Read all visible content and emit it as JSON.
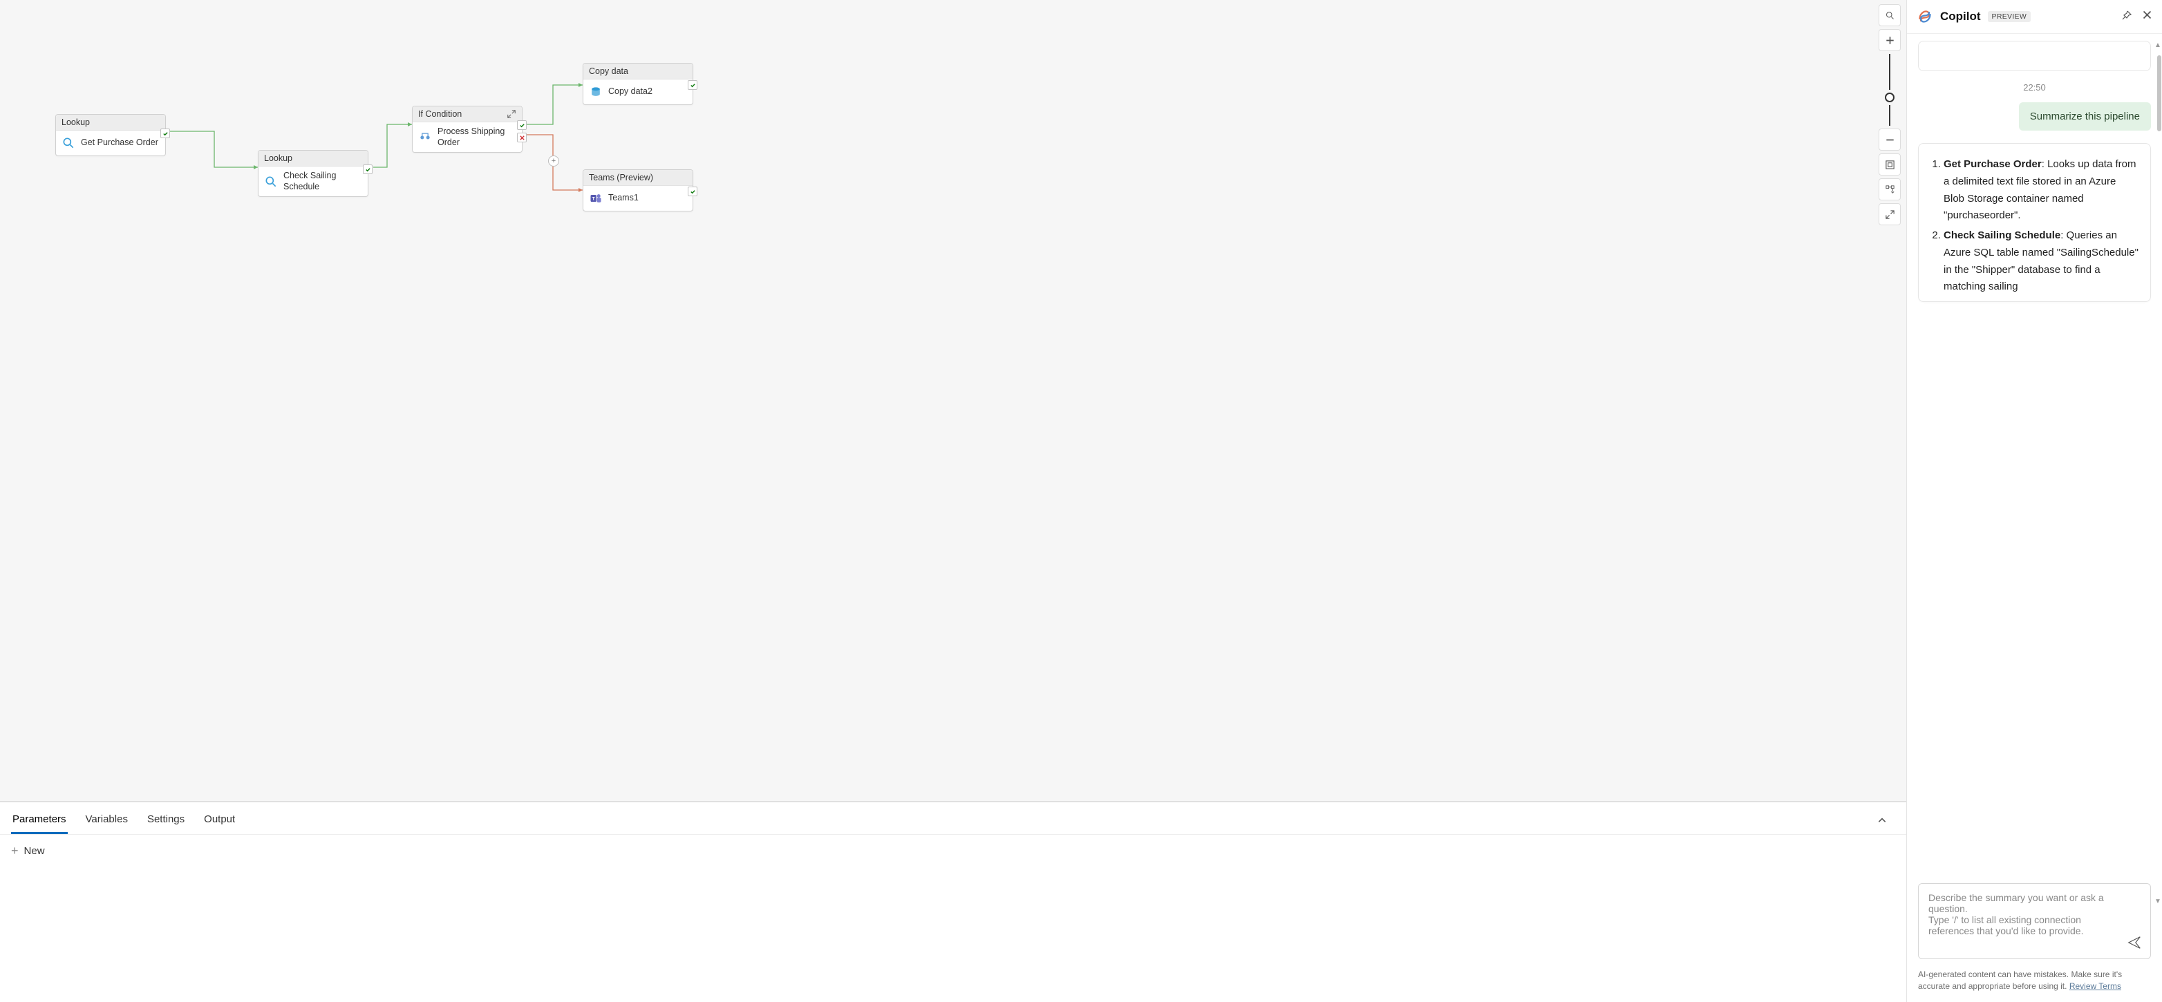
{
  "canvas": {
    "nodes": {
      "n1": {
        "type": "Lookup",
        "label": "Get Purchase Order"
      },
      "n2": {
        "type": "Lookup",
        "label": "Check Sailing Schedule"
      },
      "n3": {
        "type": "If Condition",
        "label": "Process Shipping Order"
      },
      "n4": {
        "type": "Copy data",
        "label": "Copy data2"
      },
      "n5": {
        "type": "Teams (Preview)",
        "label": "Teams1"
      }
    }
  },
  "bottom_panel": {
    "tabs": [
      "Parameters",
      "Variables",
      "Settings",
      "Output"
    ],
    "active_tab": "Parameters",
    "new_label": "New"
  },
  "copilot": {
    "title": "Copilot",
    "badge": "PREVIEW",
    "timestamp": "22:50",
    "user_message": "Summarize this pipeline",
    "assistant": {
      "item1_bold": "Get Purchase Order",
      "item1_text": ": Looks up data from a delimited text file stored in an Azure Blob Storage container named \"purchaseorder\".",
      "item2_bold": "Check Sailing Schedule",
      "item2_text": ": Queries an Azure SQL table named \"SailingSchedule\" in the \"Shipper\" database to find a matching sailing"
    },
    "input_placeholder_line1": "Describe the summary you want or ask a question.",
    "input_placeholder_line2": "Type '/' to list all existing connection references that you'd like to provide.",
    "disclaimer_text": "AI-generated content can have mistakes. Make sure it's accurate and appropriate before using it. ",
    "disclaimer_link": "Review Terms"
  }
}
